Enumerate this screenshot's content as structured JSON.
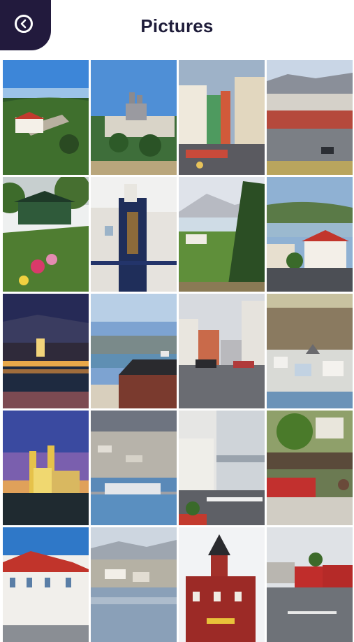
{
  "header": {
    "title": "Pictures",
    "back_icon": "back-arrow-icon"
  },
  "theme": {
    "header_bg": "#ffffff",
    "accent": "#221a3d",
    "title_color": "#1f1d3a"
  },
  "gallery": {
    "columns": 4,
    "rows": 5,
    "photos": [
      {
        "subject": "aerial-hill-house"
      },
      {
        "subject": "twin-tower-church-town"
      },
      {
        "subject": "colorful-main-street"
      },
      {
        "subject": "harbor-town-mountains"
      },
      {
        "subject": "wooden-house-garden"
      },
      {
        "subject": "tower-building-flag"
      },
      {
        "subject": "fjord-view-pine"
      },
      {
        "subject": "red-roof-houses-fjord"
      },
      {
        "subject": "night-town-church-lights"
      },
      {
        "subject": "black-roof-harbor"
      },
      {
        "subject": "pedestrian-street-cars"
      },
      {
        "subject": "hillside-town-view"
      },
      {
        "subject": "church-at-dusk"
      },
      {
        "subject": "town-and-harbor-aerial"
      },
      {
        "subject": "shopping-street"
      },
      {
        "subject": "green-house-flowers"
      },
      {
        "subject": "white-red-roof-building"
      },
      {
        "subject": "town-across-water"
      },
      {
        "subject": "red-tower-building"
      },
      {
        "subject": "street-red-houses"
      }
    ]
  }
}
